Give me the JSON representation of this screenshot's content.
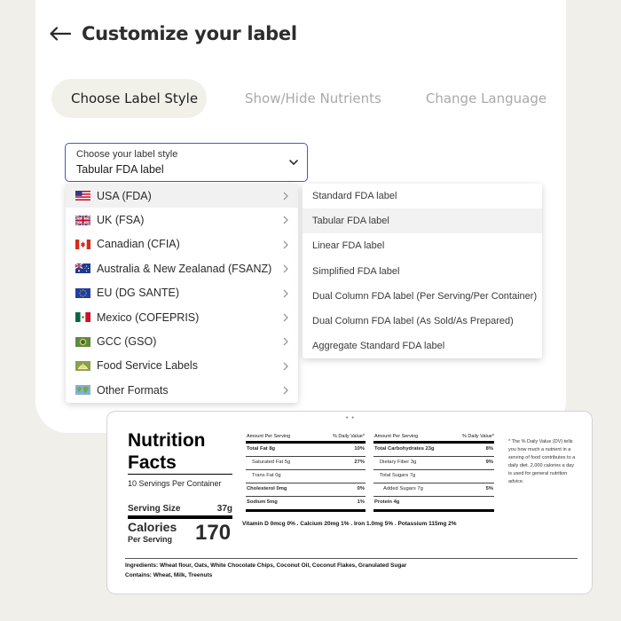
{
  "header": {
    "title": "Customize your label",
    "back_icon": "arrow-left-icon"
  },
  "tabs": [
    {
      "label": "Choose Label Style",
      "active": true
    },
    {
      "label": "Show/Hide Nutrients",
      "active": false
    },
    {
      "label": "Change Language",
      "active": false
    }
  ],
  "select": {
    "label": "Choose your label style",
    "value": "Tabular FDA label",
    "accent": "#3b5bd9"
  },
  "regions": [
    {
      "label": "USA (FDA)",
      "flag": "us-flag-icon"
    },
    {
      "label": "UK (FSA)",
      "flag": "uk-flag-icon"
    },
    {
      "label": "Canadian (CFIA)",
      "flag": "canada-flag-icon"
    },
    {
      "label": "Australia & New Zealanad (FSANZ)",
      "flag": "australia-flag-icon"
    },
    {
      "label": "EU (DG SANTE)",
      "flag": "eu-flag-icon"
    },
    {
      "label": "Mexico (COFEPRIS)",
      "flag": "mexico-flag-icon"
    },
    {
      "label": "GCC (GSO)",
      "flag": "gcc-flag-icon"
    },
    {
      "label": "Food Service Labels",
      "flag": "food-service-icon"
    },
    {
      "label": "Other Formats",
      "flag": "globe-icon"
    }
  ],
  "label_styles": [
    "Standard FDA label",
    "Tabular FDA label",
    "Linear FDA label",
    "Simplified FDA label",
    "Dual Column FDA label (Per Serving/Per Container)",
    "Dual Column FDA label (As Sold/As Prepared)",
    "Aggregate Standard FDA label"
  ],
  "label": {
    "title1": "Nutrition",
    "title2": "Facts",
    "servings": "10 Servings Per Container",
    "serving_size_label": "Serving Size",
    "serving_size_value": "37g",
    "calories_label": "Calories",
    "per_serving": "Per Serving",
    "calories_value": "170",
    "left_header_a": "Amount Per Serving",
    "left_header_b": "% Daily Value*",
    "right_header_a": "Amount Per Serving",
    "right_header_b": "% Daily Value*",
    "left_rows": [
      {
        "name": "Total Fat 8g",
        "dv": "10%"
      },
      {
        "name": "Saturated Fat 5g",
        "dv": "27%"
      },
      {
        "name": "Trans Fat 0g",
        "dv": ""
      },
      {
        "name": "Cholesterol 0mg",
        "dv": "0%"
      },
      {
        "name": "Sodium 5mg",
        "dv": "1%"
      }
    ],
    "right_rows": [
      {
        "name": "Total Carbohydrates 23g",
        "dv": "8%"
      },
      {
        "name": "Dietary Fiber 3g",
        "dv": "9%"
      },
      {
        "name": "Total Sugars 7g",
        "dv": ""
      },
      {
        "name": "Added Sugars 7g",
        "dv": "5%"
      },
      {
        "name": "Protein 4g",
        "dv": ""
      }
    ],
    "vitamins": "Vitamin D 0mcg 0% . Calcium 20mg 1% . Iron 1.0mg 5% . Potassium 115mg 2%",
    "footnote": "* The % Daily Value (DV) tells you how much a nutrient in a serving of food contributes to a daily diet. 2,000 calories a day is used for general nutrition advice.",
    "ingredients": "Ingredients: Wheat flour, Oats, White Chocolate Chips, Coconut Oil, Coconut Flakes, Granulated Sugar",
    "contains": "Contains: Wheat, Milk, Treenuts"
  }
}
